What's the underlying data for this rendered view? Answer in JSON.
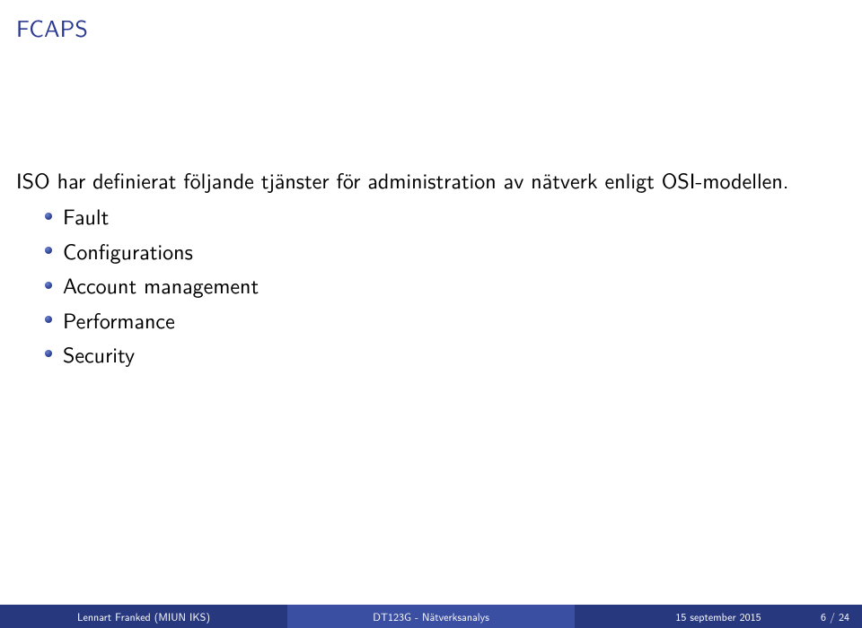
{
  "title": "FCAPS",
  "intro": "ISO har definierat följande tjänster för administration av nätverk enligt OSI-modellen.",
  "bullets": [
    "Fault",
    "Configurations",
    "Account management",
    "Performance",
    "Security"
  ],
  "footer": {
    "author": "Lennart Franked (MIUN IKS)",
    "title": "DT123G - Nätverksanalys",
    "date": "15 september 2015",
    "page": "6 / 24"
  }
}
